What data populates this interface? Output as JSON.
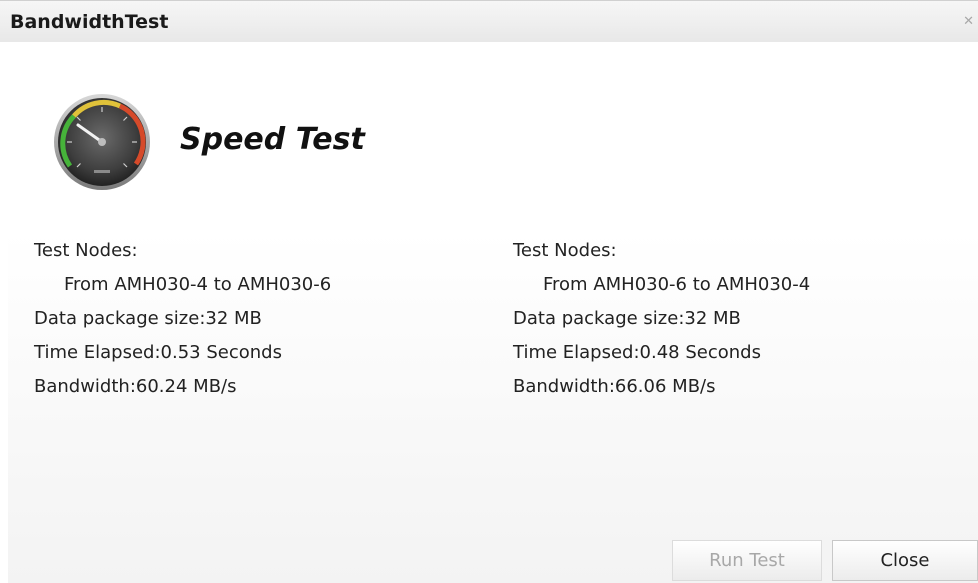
{
  "window": {
    "title": "BandwidthTest",
    "close_icon": "close-icon"
  },
  "header": {
    "heading": "Speed Test",
    "icon": "speedometer-icon"
  },
  "results": [
    {
      "nodes_label": "Test Nodes:",
      "route": "From AMH030-4 to AMH030-6",
      "package_label": "Data package size:",
      "package_value": "32 MB",
      "elapsed_label": "Time Elapsed:",
      "elapsed_value": "0.53 Seconds",
      "bandwidth_label": "Bandwidth:",
      "bandwidth_value": "60.24 MB/s"
    },
    {
      "nodes_label": "Test Nodes:",
      "route": "From AMH030-6 to AMH030-4",
      "package_label": "Data package size:",
      "package_value": "32 MB",
      "elapsed_label": "Time Elapsed:",
      "elapsed_value": "0.48 Seconds",
      "bandwidth_label": "Bandwidth:",
      "bandwidth_value": "66.06 MB/s"
    }
  ],
  "buttons": {
    "run_label": "Run Test",
    "run_enabled": false,
    "close_label": "Close"
  }
}
